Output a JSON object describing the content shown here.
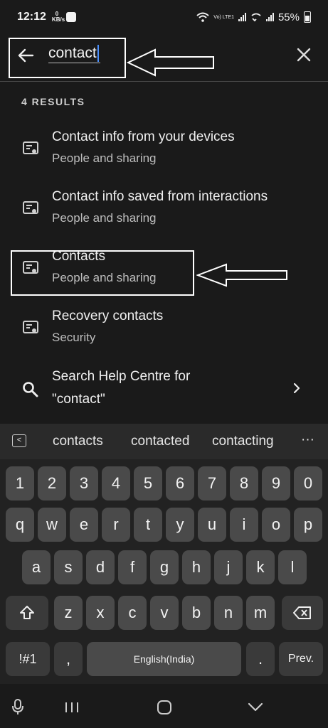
{
  "status_bar": {
    "time": "12:12",
    "data_speed_top": "0",
    "data_speed_unit": "KB/s",
    "battery": "55%",
    "network_label": "Vo) LTE1"
  },
  "search": {
    "query": "contact",
    "results_count": "4 RESULTS"
  },
  "results": [
    {
      "title": "Contact info from your devices",
      "subtitle": "People and sharing"
    },
    {
      "title": "Contact info saved from interactions",
      "subtitle": "People and sharing"
    },
    {
      "title": "Contacts",
      "subtitle": "People and sharing"
    },
    {
      "title": "Recovery contacts",
      "subtitle": "Security"
    }
  ],
  "help_search": {
    "line1": "Search Help Centre for",
    "line2": "\"contact\""
  },
  "keyboard": {
    "suggestions": [
      "contacts",
      "contacted",
      "contacting"
    ],
    "more": "···",
    "row_numbers": [
      "1",
      "2",
      "3",
      "4",
      "5",
      "6",
      "7",
      "8",
      "9",
      "0"
    ],
    "row_top": [
      "q",
      "w",
      "e",
      "r",
      "t",
      "y",
      "u",
      "i",
      "o",
      "p"
    ],
    "row_mid": [
      "a",
      "s",
      "d",
      "f",
      "g",
      "h",
      "j",
      "k",
      "l"
    ],
    "row_bottom": [
      "z",
      "x",
      "c",
      "v",
      "b",
      "n",
      "m"
    ],
    "symbols": "!#1",
    "comma": ",",
    "space": "English(India)",
    "period": ".",
    "action": "Prev."
  }
}
